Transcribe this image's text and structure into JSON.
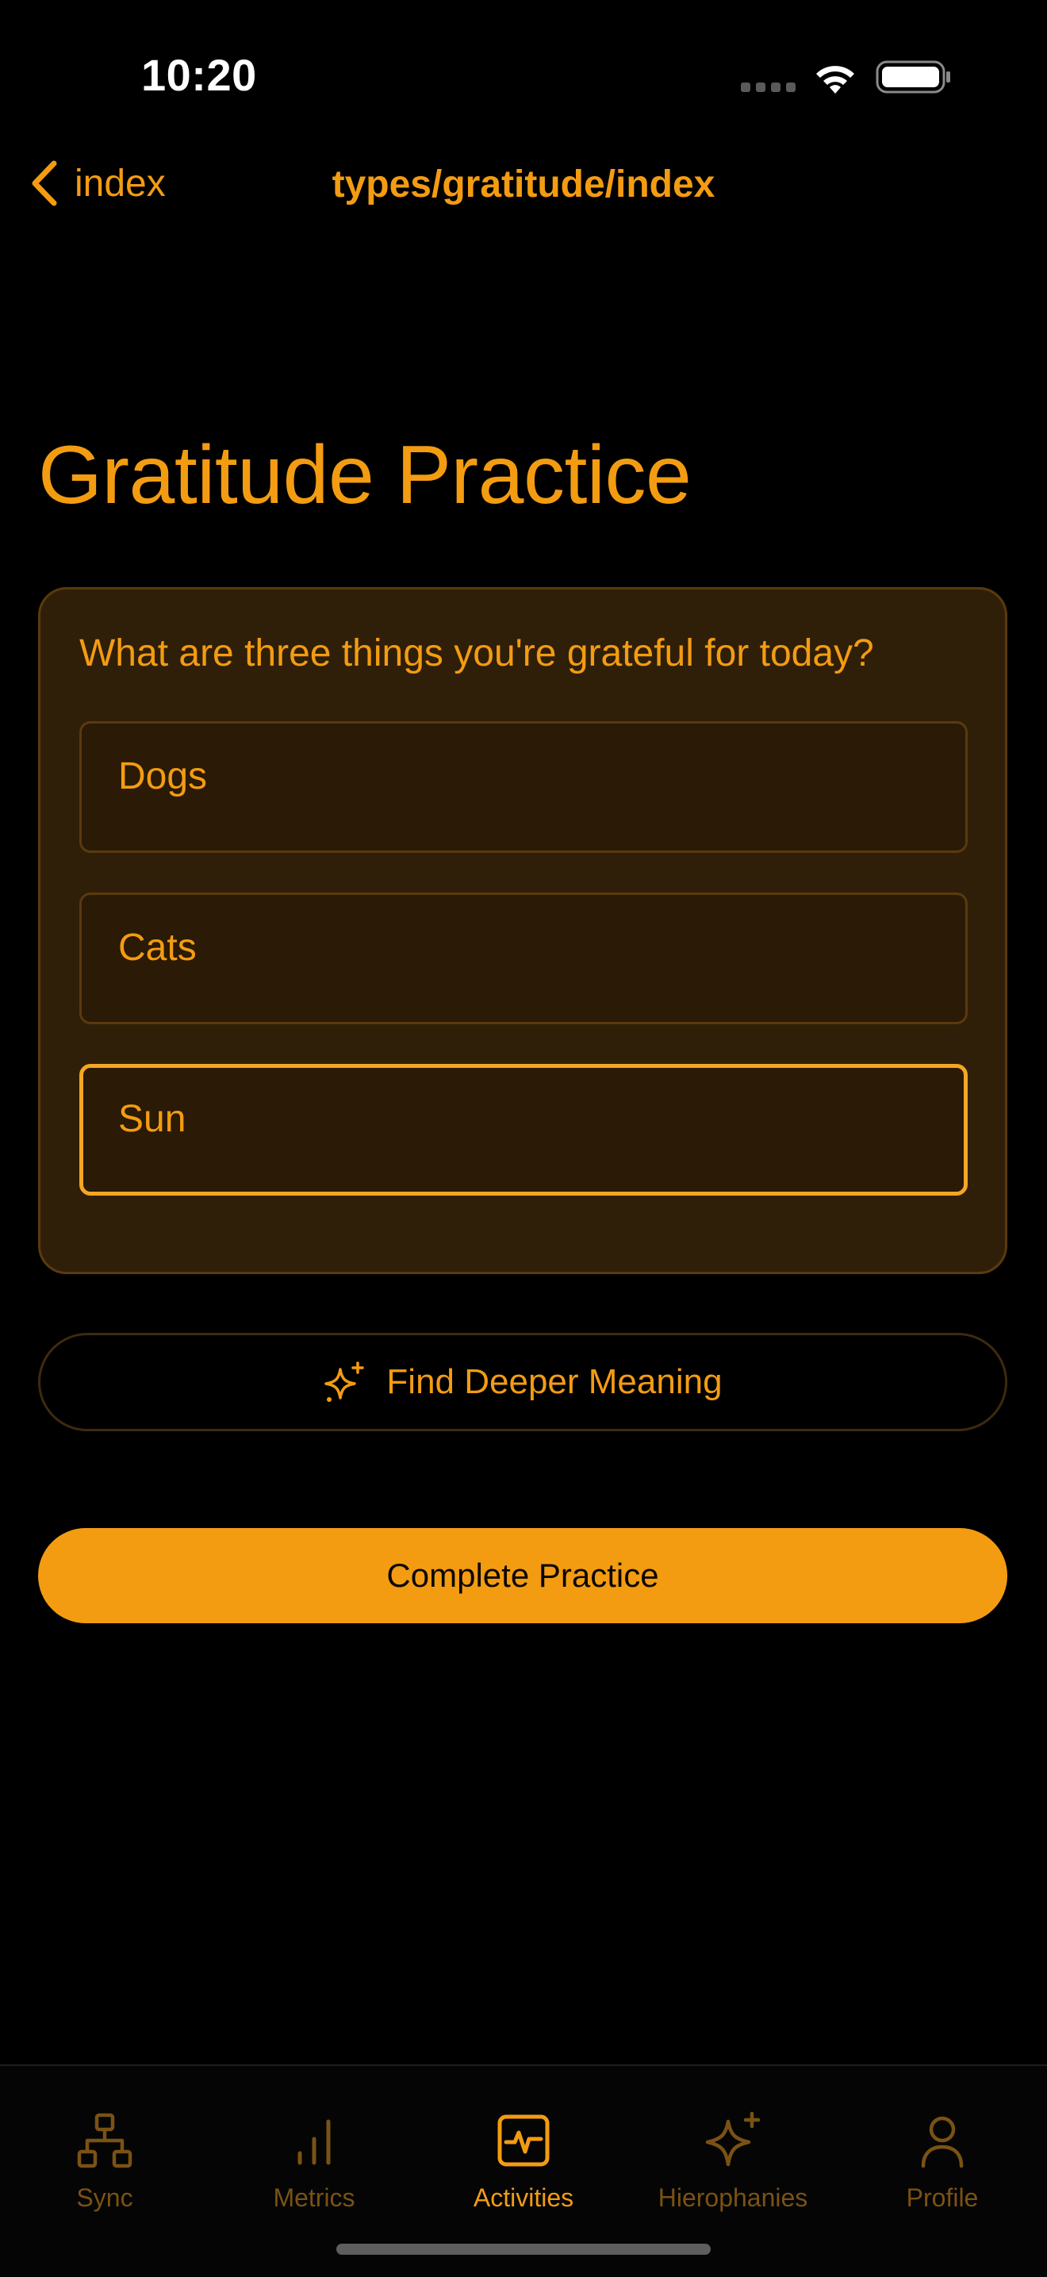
{
  "status_bar": {
    "time": "10:20"
  },
  "nav": {
    "back_label": "index",
    "title": "types/gratitude/index"
  },
  "page": {
    "title": "Gratitude Practice"
  },
  "card": {
    "prompt": "What are three things you're grateful for today?",
    "entries": [
      {
        "value": "Dogs",
        "focused": false
      },
      {
        "value": "Cats",
        "focused": false
      },
      {
        "value": "Sun",
        "focused": true
      }
    ]
  },
  "actions": {
    "deeper_label": "Find Deeper Meaning",
    "complete_label": "Complete Practice"
  },
  "tabs": [
    {
      "label": "Sync",
      "icon": "sitemap-icon",
      "active": false
    },
    {
      "label": "Metrics",
      "icon": "bar-chart-icon",
      "active": false
    },
    {
      "label": "Activities",
      "icon": "activity-icon",
      "active": true
    },
    {
      "label": "Hierophanies",
      "icon": "sparkles-icon",
      "active": false
    },
    {
      "label": "Profile",
      "icon": "user-icon",
      "active": false
    }
  ],
  "colors": {
    "accent": "#F39C12",
    "background": "#000000",
    "card": "#301F08",
    "inactive_tab": "#7A5214"
  }
}
